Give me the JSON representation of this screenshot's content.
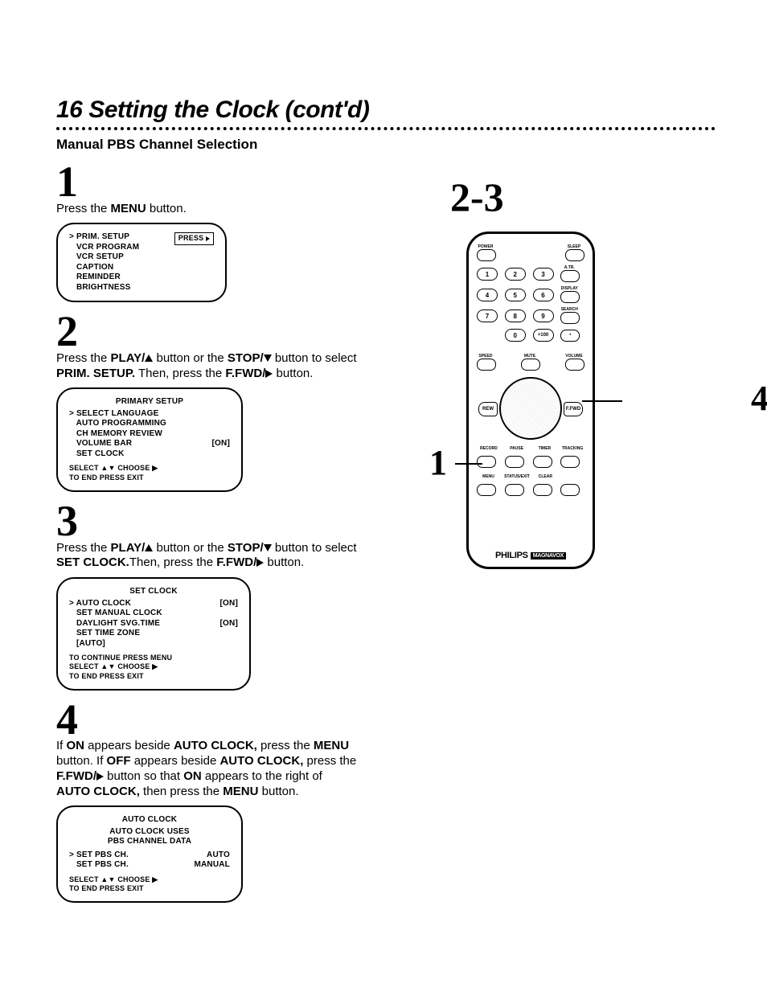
{
  "header": {
    "page_num": "16",
    "title": "Setting the Clock (cont'd)",
    "subhead": "Manual PBS Channel Selection"
  },
  "right_label": "2-3",
  "callouts": {
    "left": "1",
    "right": "4"
  },
  "steps": {
    "s1": {
      "num": "1",
      "text_a": "Press the ",
      "text_b": "MENU",
      "text_c": " button.",
      "screen": {
        "press": "PRESS",
        "lines": [
          "PRIM. SETUP",
          "VCR PROGRAM",
          "VCR SETUP",
          "CAPTION",
          "REMINDER",
          "BRIGHTNESS"
        ]
      }
    },
    "s2": {
      "num": "2",
      "t1": "Press the ",
      "t2": "PLAY/",
      "t3": " button or the ",
      "t4": "STOP/",
      "t5": " button to select ",
      "t6": "PRIM. SETUP.",
      "t7": " Then, press the ",
      "t8": "F.FWD/",
      "t9": " button.",
      "screen": {
        "title": "PRIMARY SETUP",
        "lines": [
          "SELECT LANGUAGE",
          "AUTO PROGRAMMING",
          "CH MEMORY REVIEW",
          "VOLUME BAR",
          "SET CLOCK"
        ],
        "right4": "[ON]",
        "f1": "SELECT ▲▼ CHOOSE ▶",
        "f2": "TO END PRESS EXIT"
      }
    },
    "s3": {
      "num": "3",
      "t1": "Press the ",
      "t2": "PLAY/",
      "t3": " button or the ",
      "t4": "STOP/",
      "t5": " button to select ",
      "t6": "SET CLOCK.",
      "t7": "Then, press the ",
      "t8": "F.FWD/",
      "t9": " button.",
      "screen": {
        "title": "SET CLOCK",
        "l1a": "AUTO CLOCK",
        "l1b": "[ON]",
        "l2": "SET MANUAL CLOCK",
        "l3a": "DAYLIGHT SVG.TIME",
        "l3b": "[ON]",
        "l4": "SET TIME ZONE",
        "l5": "[AUTO]",
        "f0": "TO CONTINUE PRESS MENU",
        "f1": "SELECT ▲▼ CHOOSE ▶",
        "f2": "TO END PRESS EXIT"
      }
    },
    "s4": {
      "num": "4",
      "line1a": "If ",
      "line1b": "ON",
      "line1c": " appears beside ",
      "line1d": "AUTO CLOCK,",
      "line1e": " press the ",
      "line1f": "MENU",
      "line2a": "button. If ",
      "line2b": "OFF",
      "line2c": " appears beside ",
      "line2d": "AUTO CLOCK,",
      "line2e": " press the",
      "line3a": "F.FWD/",
      "line3b": " button so that ",
      "line3c": "ON",
      "line3d": " appears to the right of",
      "line4a": "AUTO CLOCK,",
      "line4b": " then press the ",
      "line4c": "MENU",
      "line4d": " button.",
      "screen": {
        "title": "AUTO CLOCK",
        "sub1": "AUTO CLOCK USES",
        "sub2": "PBS CHANNEL DATA",
        "l1a": "SET PBS CH.",
        "l1b": "AUTO",
        "l2a": "SET PBS CH.",
        "l2b": "MANUAL",
        "f1": "SELECT ▲▼ CHOOSE ▶",
        "f2": "TO END PRESS EXIT"
      }
    }
  },
  "remote": {
    "power": "POWER",
    "sleep": "SLEEP",
    "nums": [
      "1",
      "2",
      "3",
      "4",
      "5",
      "6",
      "7",
      "8",
      "9",
      "0",
      "+100",
      "•"
    ],
    "side_labels": [
      "A.TR.",
      "DISPLAY",
      "SEARCH"
    ],
    "speed": "SPEED",
    "mute": "MUTE",
    "volume": "VOLUME",
    "rew": "REW",
    "ffwd": "F.FWD",
    "row_a": [
      "RECORD",
      "PAUSE",
      "TIMER",
      "TRACKING"
    ],
    "row_b": [
      "MENU",
      "STATUS/EXIT",
      "CLEAR",
      ""
    ],
    "brand": "PHILIPS",
    "brand2": "MAGNAVOX"
  }
}
